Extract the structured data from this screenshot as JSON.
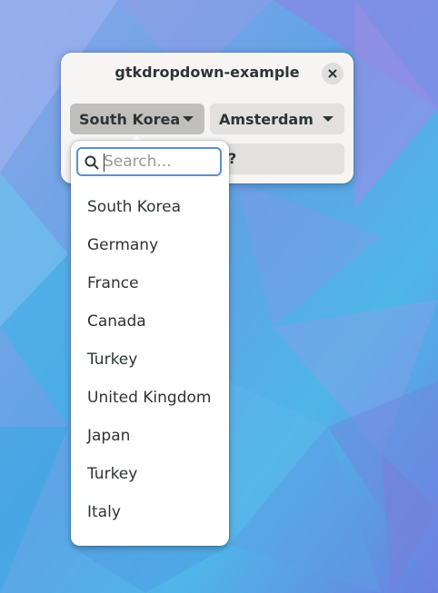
{
  "window": {
    "title": "gtkdropdown-example",
    "close_icon": "close-icon"
  },
  "dropdowns": {
    "country": {
      "selected": "South Korea",
      "icon": "chevron-down-icon",
      "state": "open"
    },
    "city": {
      "selected": "Amsterdam",
      "icon": "chevron-down-icon"
    },
    "third": {
      "visible_text": "?"
    }
  },
  "popover": {
    "search": {
      "placeholder": "Search...",
      "value": "",
      "icon": "search-icon"
    },
    "items": [
      "South Korea",
      "Germany",
      "France",
      "Canada",
      "Turkey",
      "United Kingdom",
      "Japan",
      "Turkey",
      "Italy"
    ]
  },
  "colors": {
    "accent": "#5b8fd0",
    "window_bg": "#f6f5f4",
    "active_button": "#c0bfbc",
    "button": "#e2e1df",
    "text": "#2e3436"
  }
}
